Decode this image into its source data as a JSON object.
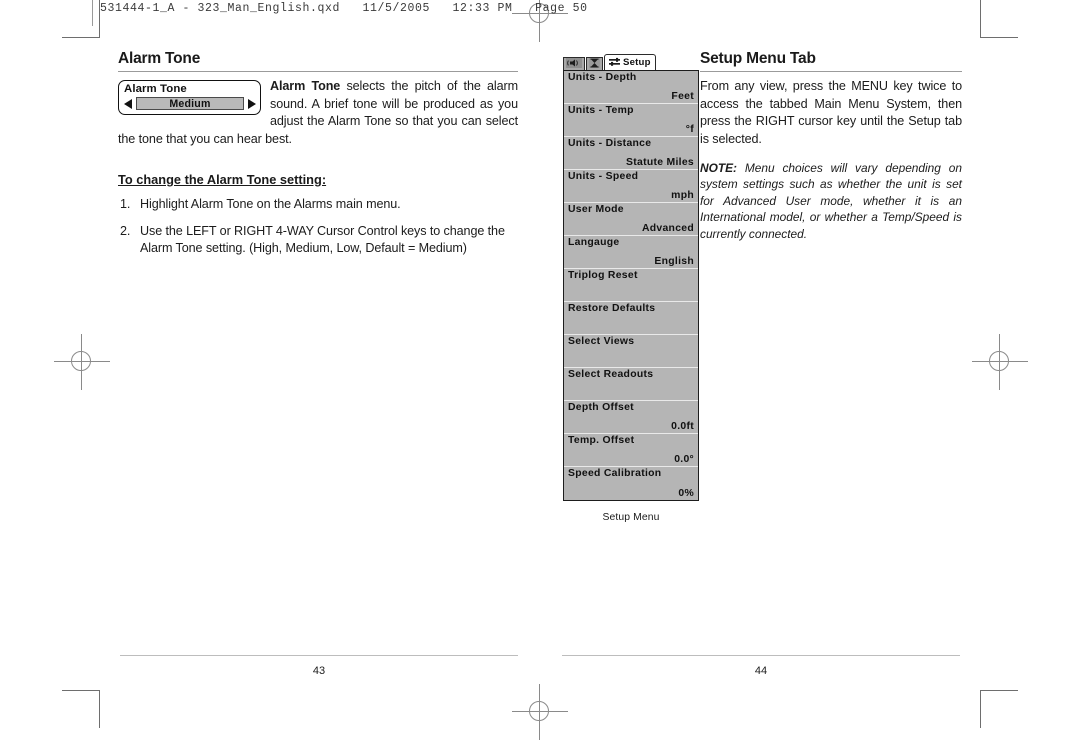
{
  "slug": "531444-1_A - 323_Man_English.qxd   11/5/2005   12:33 PM   Page 50",
  "left_page": {
    "heading": "Alarm Tone",
    "widget": {
      "title": "Alarm Tone",
      "value": "Medium",
      "left_arrow_icon": "triangle-left-icon",
      "right_arrow_icon": "triangle-right-icon"
    },
    "intro_bold": "Alarm Tone",
    "intro_rest": " selects the pitch of the alarm sound. A brief tone will be produced as you adjust the Alarm Tone so that you can select the tone that you can hear best.",
    "subhead": "To change the Alarm Tone setting:",
    "steps": [
      {
        "num": "1.",
        "text": "Highlight Alarm Tone on the Alarms main menu."
      },
      {
        "num": "2.",
        "text": "Use the LEFT or RIGHT 4-WAY Cursor Control keys to change the Alarm Tone setting. (High, Medium, Low, Default = Medium)"
      }
    ],
    "page_number": "43"
  },
  "right_page": {
    "heading": "Setup Menu Tab",
    "body": "From any view, press the MENU key twice to access the tabbed Main Menu System, then press the RIGHT cursor key until the Setup tab is selected.",
    "note_label": "NOTE:",
    "note_text": " Menu choices will vary depending on system settings such as whether the unit is set for Advanced User mode, whether it is an International model, or whether a Temp/Speed is currently connected.",
    "page_number": "44"
  },
  "lcd": {
    "tabs": [
      {
        "label": "",
        "icon": "alarm-speaker-icon",
        "selected": false
      },
      {
        "label": "",
        "icon": "hourglass-icon",
        "selected": false
      },
      {
        "label": "Setup",
        "icon": "sliders-icon",
        "selected": true
      }
    ],
    "menu_items": [
      {
        "label": "Units - Depth",
        "value": "Feet"
      },
      {
        "label": "Units - Temp",
        "value": "°f"
      },
      {
        "label": "Units - Distance",
        "value": "Statute Miles"
      },
      {
        "label": "Units - Speed",
        "value": "mph"
      },
      {
        "label": "User Mode",
        "value": "Advanced"
      },
      {
        "label": "Langauge",
        "value": "English"
      },
      {
        "label": "Triplog Reset",
        "value": ""
      },
      {
        "label": "Restore Defaults",
        "value": ""
      },
      {
        "label": "Select Views",
        "value": ""
      },
      {
        "label": "Select Readouts",
        "value": ""
      },
      {
        "label": "Depth Offset",
        "value": "0.0ft"
      },
      {
        "label": "Temp. Offset",
        "value": "0.0°"
      },
      {
        "label": "Speed Calibration",
        "value": "0%"
      }
    ],
    "caption": "Setup Menu"
  }
}
